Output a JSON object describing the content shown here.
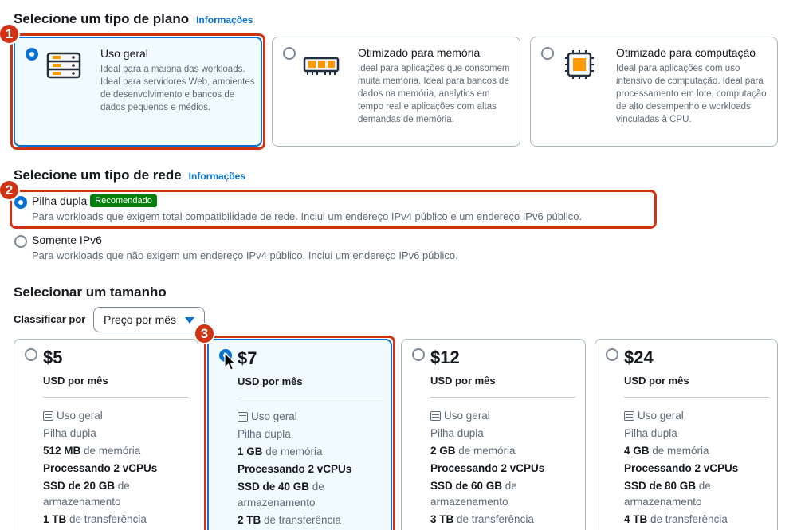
{
  "plan_section": {
    "title": "Selecione um tipo de plano",
    "info": "Informações",
    "plans": [
      {
        "name": "Uso geral",
        "desc": "Ideal para a maioria das workloads. Ideal para servidores Web, ambientes de desenvolvimento e bancos de dados pequenos e médios.",
        "selected": true,
        "icon": "server-icon"
      },
      {
        "name": "Otimizado para memória",
        "desc": "Ideal para aplicações que consomem muita memória. Ideal para bancos de dados na memória, analytics em tempo real e aplicações com altas demandas de memória.",
        "selected": false,
        "icon": "memory-icon"
      },
      {
        "name": "Otimizado para computação",
        "desc": "Ideal para aplicações com uso intensivo de computação. Ideal para processamento em lote, computação de alto desempenho e workloads vinculadas à CPU.",
        "selected": false,
        "icon": "cpu-icon"
      }
    ]
  },
  "network_section": {
    "title": "Selecione um tipo de rede",
    "info": "Informações",
    "options": [
      {
        "label": "Pilha dupla",
        "badge": "Recomendado",
        "desc": "Para workloads que exigem total compatibilidade de rede. Inclui um endereço IPv4 público e um endereço IPv6 público.",
        "selected": true
      },
      {
        "label": "Somente IPv6",
        "desc": "Para workloads que não exigem um endereço IPv4 público. Inclui um endereço IPv6 público.",
        "selected": false
      }
    ]
  },
  "size_section": {
    "title": "Selecionar um tamanho",
    "sort_label": "Classificar por",
    "sort_value": "Preço por mês",
    "sizes": [
      {
        "price": "$5",
        "per": "USD por mês",
        "plan": "Uso geral",
        "network": "Pilha dupla",
        "memory_value": "512 MB",
        "memory_suffix": " de memória",
        "cpu": "Processando 2 vCPUs",
        "ssd_value": "SSD de 20 GB",
        "ssd_suffix": " de",
        "storage": "armazenamento",
        "transfer_value": "1 TB",
        "transfer_suffix": " de transferência",
        "selected": false
      },
      {
        "price": "$7",
        "per": "USD por mês",
        "plan": "Uso geral",
        "network": "Pilha dupla",
        "memory_value": "1 GB",
        "memory_suffix": " de memória",
        "cpu": "Processando 2 vCPUs",
        "ssd_value": "SSD de 40 GB",
        "ssd_suffix": " de",
        "storage": "armazenamento",
        "transfer_value": "2 TB",
        "transfer_suffix": " de transferência",
        "selected": true
      },
      {
        "price": "$12",
        "per": "USD por mês",
        "plan": "Uso geral",
        "network": "Pilha dupla",
        "memory_value": "2 GB",
        "memory_suffix": " de memória",
        "cpu": "Processando 2 vCPUs",
        "ssd_value": "SSD de 60 GB",
        "ssd_suffix": " de",
        "storage": "armazenamento",
        "transfer_value": "3 TB",
        "transfer_suffix": " de transferência",
        "selected": false
      },
      {
        "price": "$24",
        "per": "USD por mês",
        "plan": "Uso geral",
        "network": "Pilha dupla",
        "memory_value": "4 GB",
        "memory_suffix": " de memória",
        "cpu": "Processando 2 vCPUs",
        "ssd_value": "SSD de 80 GB",
        "ssd_suffix": " de",
        "storage": "armazenamento",
        "transfer_value": "4 TB",
        "transfer_suffix": " de transferência",
        "selected": false
      }
    ]
  },
  "steps": [
    "1",
    "2",
    "3"
  ],
  "colors": {
    "accent": "#0972d3",
    "highlight": "#d13212",
    "recommended": "#037f0c"
  }
}
